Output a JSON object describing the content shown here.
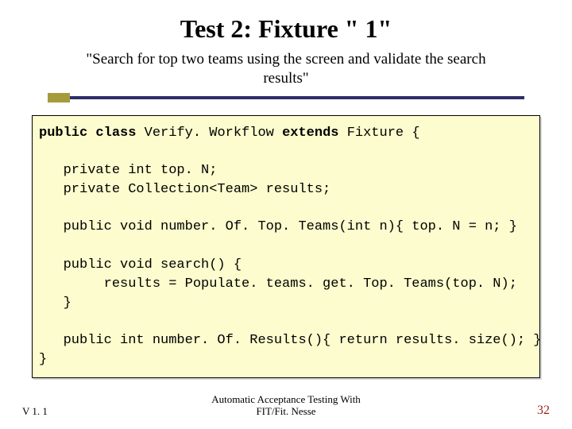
{
  "title": "Test 2: Fixture \" 1\"",
  "subtitle": "\"Search for top two teams using the screen and validate the search results\"",
  "code": {
    "l1a": "public",
    "l1b": " class",
    "l1c": " Verify. Workflow ",
    "l1d": "extends",
    "l1e": " Fixture {",
    "l2": "   private int top. N;",
    "l3": "   private Collection<Team> results;",
    "l4": "   public void number. Of. Top. Teams(int n){ top. N = n; }",
    "l5": "   public void search() {",
    "l6": "        results = Populate. teams. get. Top. Teams(top. N);",
    "l7": "   }",
    "l8": "   public int number. Of. Results(){ return results. size(); }",
    "l9": "}"
  },
  "footer": {
    "version": "V 1. 1",
    "center_line1": "Automatic Acceptance Testing With",
    "center_line2": "FIT/Fit. Nesse",
    "page": "32"
  }
}
